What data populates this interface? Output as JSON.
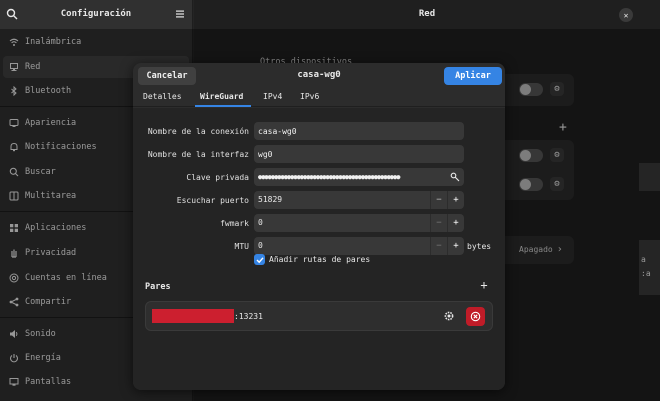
{
  "sidebar": {
    "title": "Configuración",
    "items": [
      {
        "label": "Inalámbrica",
        "icon": "wifi-icon"
      },
      {
        "label": "Red",
        "icon": "network-icon",
        "active": true
      },
      {
        "label": "Bluetooth",
        "icon": "bluetooth-icon"
      },
      {
        "label": "Apariencia",
        "icon": "appearance-icon"
      },
      {
        "label": "Notificaciones",
        "icon": "bell-icon"
      },
      {
        "label": "Buscar",
        "icon": "search-icon"
      },
      {
        "label": "Multitarea",
        "icon": "multitask-icon"
      },
      {
        "label": "Aplicaciones",
        "icon": "apps-icon"
      },
      {
        "label": "Privacidad",
        "icon": "hand-icon"
      },
      {
        "label": "Cuentas en línea",
        "icon": "at-icon"
      },
      {
        "label": "Compartir",
        "icon": "share-icon"
      },
      {
        "label": "Sonido",
        "icon": "speaker-icon"
      },
      {
        "label": "Energía",
        "icon": "power-icon"
      },
      {
        "label": "Pantallas",
        "icon": "display-icon"
      }
    ]
  },
  "main": {
    "title": "Red",
    "section_label": "Otros dispositivos",
    "status": "Apagado",
    "side_text_1": "a",
    "side_text_2": ":a"
  },
  "dialog": {
    "title": "casa-wg0",
    "cancel_label": "Cancelar",
    "apply_label": "Aplicar",
    "tabs": [
      "Detalles",
      "WireGuard",
      "IPv4",
      "IPv6"
    ],
    "active_tab": "WireGuard",
    "fields": {
      "connection_name_label": "Nombre de la conexión",
      "connection_name_value": "casa-wg0",
      "interface_name_label": "Nombre de la interfaz",
      "interface_name_value": "wg0",
      "private_key_label": "Clave privada",
      "private_key_value": "●●●●●●●●●●●●●●●●●●●●●●●●●●●●●●●●●●●●●●●●●●●●",
      "listen_port_label": "Escuchar puerto",
      "listen_port_value": "51829",
      "fwmark_label": "fwmark",
      "fwmark_value": "0",
      "mtu_label": "MTU",
      "mtu_value": "0",
      "mtu_unit": "bytes",
      "add_routes_label": "Añadir rutas de pares",
      "add_routes_checked": true
    },
    "peers": {
      "title": "Pares",
      "items": [
        {
          "endpoint_suffix": ":13231"
        }
      ]
    }
  },
  "colors": {
    "accent": "#3584e4",
    "destructive": "#c01c28",
    "redaction": "#cc1f2f"
  }
}
